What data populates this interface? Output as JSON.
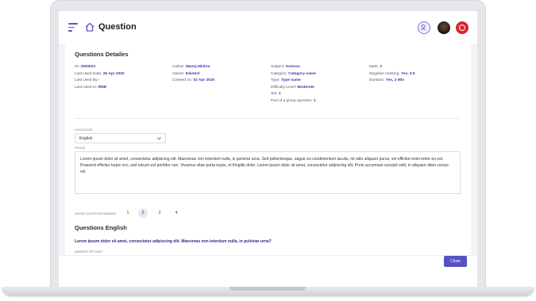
{
  "header": {
    "title": "Question"
  },
  "details": {
    "section_title": "Questions Detailes",
    "col1": [
      {
        "label": "ID: ",
        "value": "OI00023"
      },
      {
        "label": "Last Used Date: ",
        "value": "26 Apr 2020"
      },
      {
        "label": "Last Used By:- ",
        "value": ""
      },
      {
        "label": "Last Used In: ",
        "value": "RRB"
      }
    ],
    "col2": [
      {
        "label": "Author: ",
        "value": "Manoj Mishra"
      },
      {
        "label": "Owner: ",
        "value": "Edutest"
      },
      {
        "label": "Created on: ",
        "value": "02 Apr 2020"
      }
    ],
    "col3": [
      {
        "label": "Subject: ",
        "value": "Science"
      },
      {
        "label": "Category: ",
        "value": "Category name"
      },
      {
        "label": "Type: ",
        "value": "Type name"
      },
      {
        "label": "Difficulty Level: ",
        "value": "Moderate"
      },
      {
        "label": "Set: ",
        "value": "1"
      },
      {
        "label": "Part of a group question: ",
        "value": "1"
      }
    ],
    "col4": [
      {
        "label": "Mark: ",
        "value": "2"
      },
      {
        "label": "Negative marking: ",
        "value": "Yes, 0.5"
      },
      {
        "label": "Duration: ",
        "value": "Yes, 2 Min"
      }
    ]
  },
  "language": {
    "label": "LANGUAGE",
    "value": "English"
  },
  "passage": {
    "label": "PRASE",
    "text": "Lorem ipsum dolor sit amet, consectetur adipiscing elit. Maecenas non interdum nulla, in pulvinar urna. Sed pellentesque, augue eu condimentum iaculis, mi odio aliquam purus, vel efficitur enim tortor eu est. Praesent efficitur turpis orci, sed rutrum est porttitor non. Vivamus vitae porta turpis, et fringilla dolor. Lorem ipsum dolor sit amet, consectetur adipiscing elit. Proin accumsan suscipit velit, in aliquam diam cursus vel."
  },
  "group_pager": {
    "label": "GROUP QUESTION NUMBER",
    "pages": [
      "1",
      "2",
      "3",
      "4"
    ],
    "active_index": 1
  },
  "question": {
    "section_title": "Questions English",
    "text": "Lorem ipsum dolor sit amet, consectetur adipiscing elit. Maecenas non interdum nulla, in pulvinar urna?",
    "answer_label": "ANSWER OPTIONS"
  },
  "footer": {
    "close_label": "Close"
  },
  "colors": {
    "accent": "#5452c2",
    "link": "#3a38a8"
  },
  "icons": {
    "menu": "hamburger-icon",
    "home": "home-icon",
    "help": "help-icon",
    "avatar": "user-avatar",
    "flag": "flag-icon"
  }
}
